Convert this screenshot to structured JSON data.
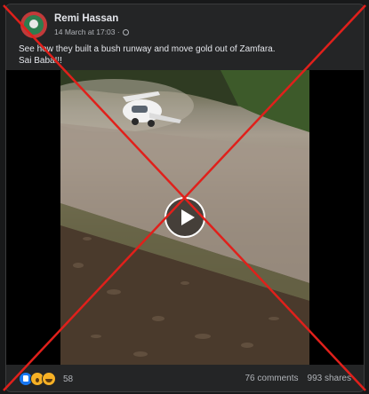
{
  "post": {
    "author": "Remi Hassan",
    "timestamp": "14 March at 17:03 ·",
    "text_line1": "See how they built a bush runway and move gold out of Zamfara.",
    "text_line2": "Sai Baba!!!"
  },
  "media": {
    "type": "video",
    "play_icon": "play-icon"
  },
  "footer": {
    "reaction_icons": [
      "like-icon",
      "wow-icon",
      "haha-icon"
    ],
    "reaction_count": "58",
    "comments": "76 comments",
    "shares": "993 shares"
  },
  "overlay": {
    "mark": "red-x-cross",
    "color": "#e0201b"
  },
  "colors": {
    "background": "#18191a",
    "card": "#242526",
    "text": "#e4e6eb",
    "muted": "#b0b3b8"
  }
}
